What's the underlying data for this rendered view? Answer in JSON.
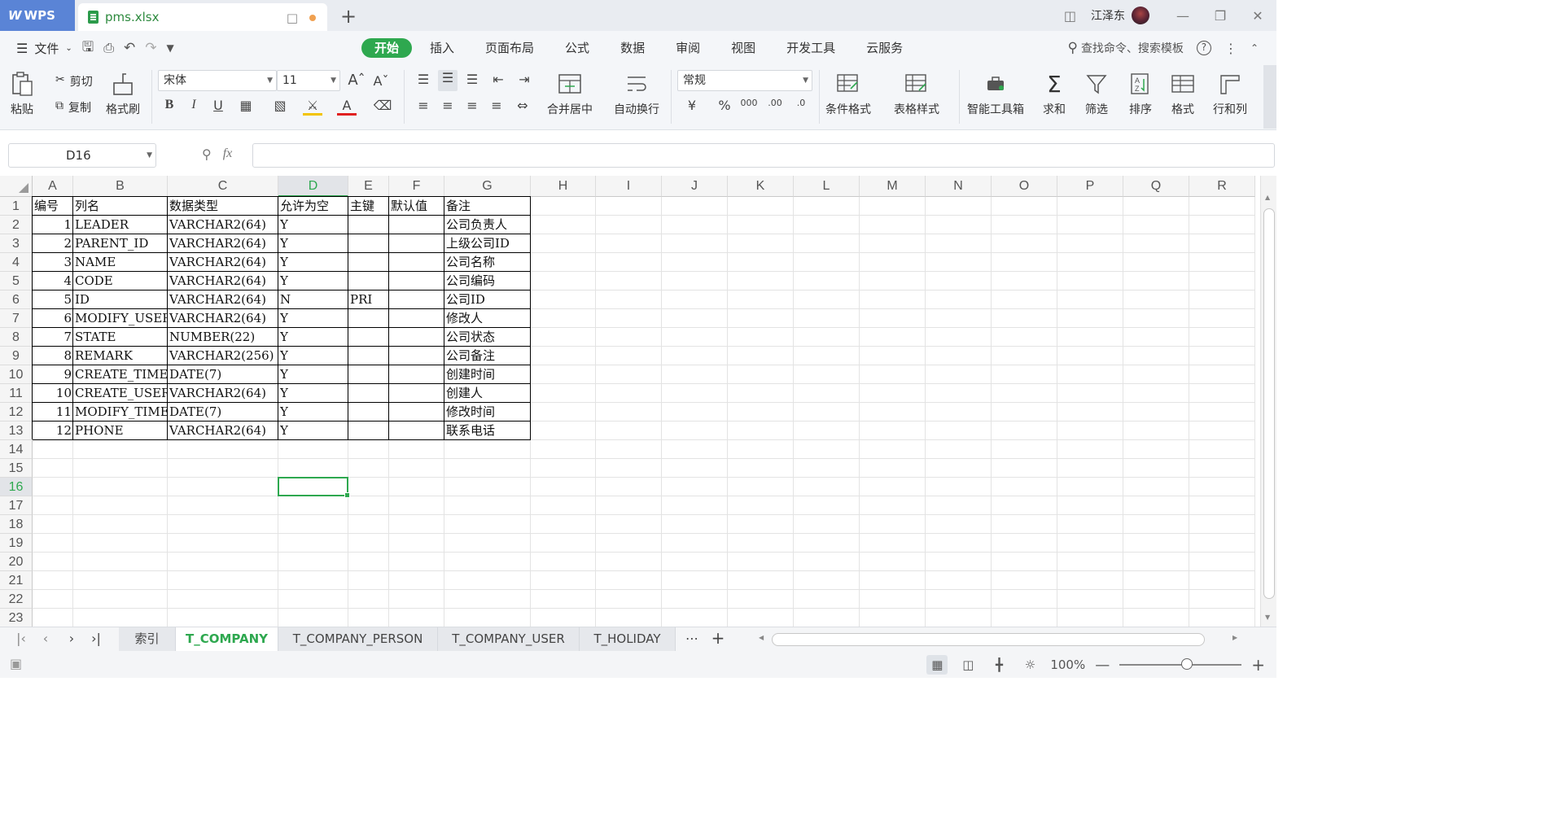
{
  "titlebar": {
    "app_name": "WPS",
    "file_tab": "pms.xlsx",
    "user_name": "江泽东"
  },
  "menu": {
    "file_label": "文件",
    "tabs": [
      "开始",
      "插入",
      "页面布局",
      "公式",
      "数据",
      "审阅",
      "视图",
      "开发工具",
      "云服务"
    ],
    "active_tab": "开始",
    "search_placeholder": "查找命令、搜索模板"
  },
  "ribbon": {
    "paste": "粘贴",
    "cut": "剪切",
    "copy": "复制",
    "format_painter": "格式刷",
    "font_name": "宋体",
    "font_size": "11",
    "merge_center": "合并居中",
    "wrap_text": "自动换行",
    "number_format": "常规",
    "conditional_format": "条件格式",
    "table_style": "表格样式",
    "smart_toolbox": "智能工具箱",
    "sum": "求和",
    "filter": "筛选",
    "sort": "排序",
    "format": "格式",
    "row_col": "行和列"
  },
  "formula_bar": {
    "name_box": "D16",
    "fx": "fx",
    "formula": ""
  },
  "columns": [
    "A",
    "B",
    "C",
    "D",
    "E",
    "F",
    "G",
    "H",
    "I",
    "J",
    "K",
    "L",
    "M",
    "N",
    "O",
    "P",
    "Q",
    "R"
  ],
  "rows": [
    "1",
    "2",
    "3",
    "4",
    "5",
    "6",
    "7",
    "8",
    "9",
    "10",
    "11",
    "12",
    "13",
    "14",
    "15",
    "16",
    "17",
    "18",
    "19",
    "20",
    "21",
    "22",
    "23"
  ],
  "selected_cell": {
    "column": "D",
    "row": "16"
  },
  "table": {
    "headers": [
      "编号",
      "列名",
      "数据类型",
      "允许为空",
      "主键",
      "默认值",
      "备注"
    ],
    "rows": [
      {
        "no": "1",
        "name": "LEADER",
        "type": "VARCHAR2(64)",
        "nullable": "Y",
        "pk": "",
        "default": "",
        "remark": "公司负责人"
      },
      {
        "no": "2",
        "name": "PARENT_ID",
        "type": "VARCHAR2(64)",
        "nullable": "Y",
        "pk": "",
        "default": "",
        "remark": "上级公司ID"
      },
      {
        "no": "3",
        "name": "NAME",
        "type": "VARCHAR2(64)",
        "nullable": "Y",
        "pk": "",
        "default": "",
        "remark": "公司名称"
      },
      {
        "no": "4",
        "name": "CODE",
        "type": "VARCHAR2(64)",
        "nullable": "Y",
        "pk": "",
        "default": "",
        "remark": "公司编码"
      },
      {
        "no": "5",
        "name": "ID",
        "type": "VARCHAR2(64)",
        "nullable": "N",
        "pk": "PRI",
        "default": "",
        "remark": "公司ID"
      },
      {
        "no": "6",
        "name": "MODIFY_USER",
        "type": "VARCHAR2(64)",
        "nullable": "Y",
        "pk": "",
        "default": "",
        "remark": "修改人"
      },
      {
        "no": "7",
        "name": "STATE",
        "type": "NUMBER(22)",
        "nullable": "Y",
        "pk": "",
        "default": "",
        "remark": "公司状态"
      },
      {
        "no": "8",
        "name": "REMARK",
        "type": "VARCHAR2(256)",
        "nullable": "Y",
        "pk": "",
        "default": "",
        "remark": "公司备注"
      },
      {
        "no": "9",
        "name": "CREATE_TIME",
        "type": "DATE(7)",
        "nullable": "Y",
        "pk": "",
        "default": "",
        "remark": "创建时间"
      },
      {
        "no": "10",
        "name": "CREATE_USER",
        "type": "VARCHAR2(64)",
        "nullable": "Y",
        "pk": "",
        "default": "",
        "remark": "创建人"
      },
      {
        "no": "11",
        "name": "MODIFY_TIME",
        "type": "DATE(7)",
        "nullable": "Y",
        "pk": "",
        "default": "",
        "remark": "修改时间"
      },
      {
        "no": "12",
        "name": "PHONE",
        "type": "VARCHAR2(64)",
        "nullable": "Y",
        "pk": "",
        "default": "",
        "remark": "联系电话"
      }
    ]
  },
  "sheets": [
    "索引",
    "T_COMPANY",
    "T_COMPANY_PERSON",
    "T_COMPANY_USER",
    "T_HOLIDAY"
  ],
  "active_sheet": "T_COMPANY",
  "status": {
    "zoom": "100%"
  },
  "colors": {
    "accent": "#2ea84f",
    "wps_blue": "#5a84d6"
  }
}
